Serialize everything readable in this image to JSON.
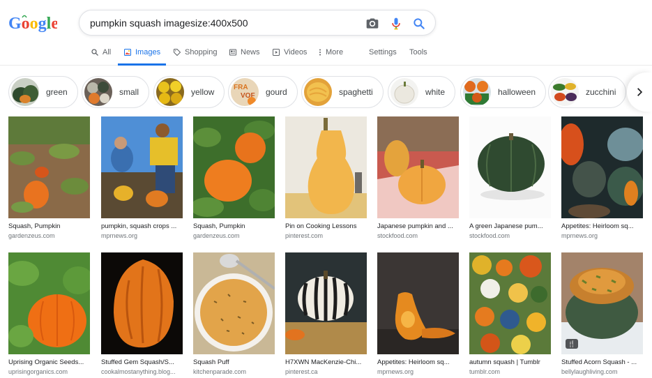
{
  "logo": {
    "text": "Google",
    "letters": [
      "G",
      "o",
      "o",
      "g",
      "l",
      "e"
    ]
  },
  "search": {
    "query": "pumpkin squash imagesize:400x500"
  },
  "tabs": [
    {
      "label": "All",
      "icon": "search-icon"
    },
    {
      "label": "Images",
      "icon": "image-icon",
      "active": true
    },
    {
      "label": "Shopping",
      "icon": "tag-icon"
    },
    {
      "label": "News",
      "icon": "news-icon"
    },
    {
      "label": "Videos",
      "icon": "video-icon"
    },
    {
      "label": "More",
      "icon": "more-vert-icon"
    },
    {
      "label": "Settings"
    },
    {
      "label": "Tools"
    }
  ],
  "chips": [
    {
      "label": "green"
    },
    {
      "label": "small"
    },
    {
      "label": "yellow"
    },
    {
      "label": "gourd"
    },
    {
      "label": "spaghetti"
    },
    {
      "label": "white"
    },
    {
      "label": "halloween"
    },
    {
      "label": "zucchini"
    }
  ],
  "results": [
    {
      "title": "Squash, Pumpkin",
      "source": "gardenzeus.com"
    },
    {
      "title": "pumpkin, squash crops ...",
      "source": "mprnews.org"
    },
    {
      "title": "Squash, Pumpkin",
      "source": "gardenzeus.com"
    },
    {
      "title": "Pin on Cooking Lessons",
      "source": "pinterest.com"
    },
    {
      "title": "Japanese pumpkin and ...",
      "source": "stockfood.com"
    },
    {
      "title": "A green Japanese pum...",
      "source": "stockfood.com"
    },
    {
      "title": "Appetites: Heirloom sq...",
      "source": "mprnews.org"
    },
    {
      "title": "Uprising Organic Seeds...",
      "source": "uprisingorganics.com"
    },
    {
      "title": "Stuffed Gem Squash/S...",
      "source": "cookalmostanything.blog..."
    },
    {
      "title": "Squash Puff",
      "source": "kitchenparade.com"
    },
    {
      "title": "H7XWN MacKenzie-Chi...",
      "source": "pinterest.ca"
    },
    {
      "title": "Appetites: Heirloom sq...",
      "source": "mprnews.org"
    },
    {
      "title": "autumn squash | Tumblr",
      "source": "tumblr.com"
    },
    {
      "title": "Stuffed Acorn Squash - ...",
      "source": "bellylaughliving.com"
    }
  ],
  "colors": {
    "accent": "#1a73e8",
    "logo_g": "#4285f4",
    "logo_o1": "#ea4335",
    "logo_o2": "#fbbc05",
    "logo_l": "#34a853"
  }
}
